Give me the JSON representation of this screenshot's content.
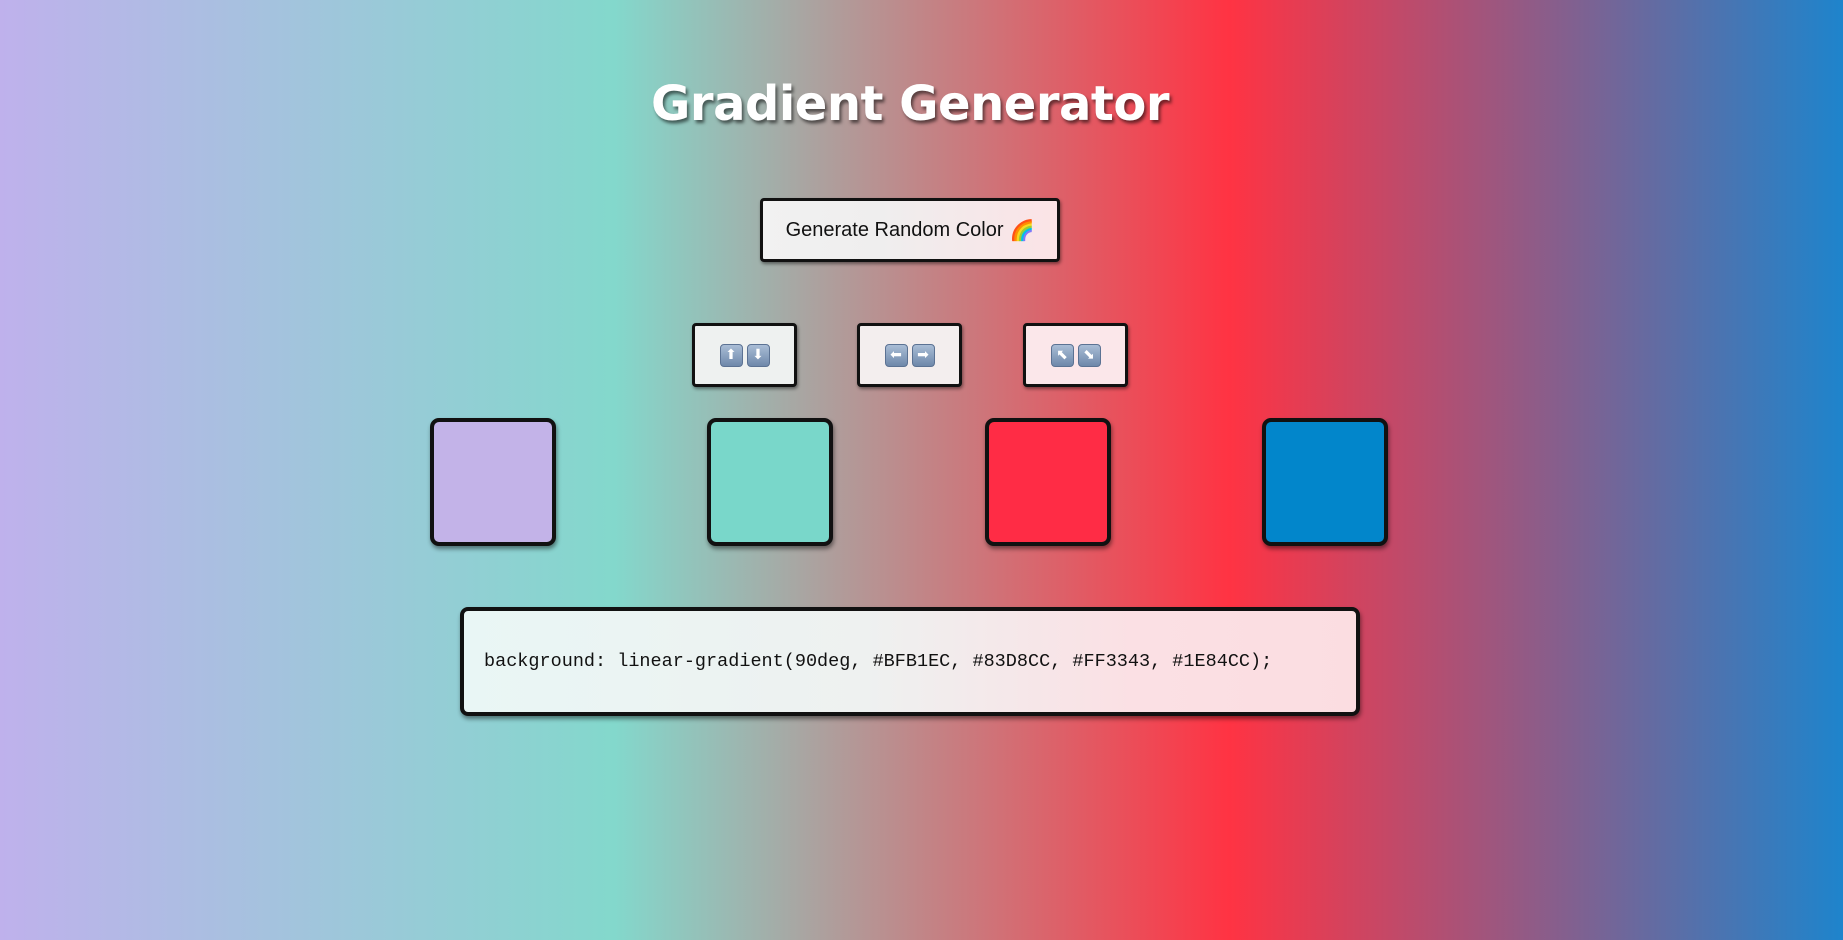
{
  "title": "Gradient Generator",
  "generate_button": {
    "label": "Generate Random Color",
    "icon": "rainbow-emoji",
    "emoji": "🌈"
  },
  "direction_buttons": [
    {
      "name": "vertical",
      "icons": [
        "arrow-up-icon",
        "arrow-down-icon"
      ],
      "glyphs": [
        "⬆",
        "⬇"
      ]
    },
    {
      "name": "horizontal",
      "icons": [
        "arrow-left-icon",
        "arrow-right-icon"
      ],
      "glyphs": [
        "⬅",
        "➡"
      ]
    },
    {
      "name": "diagonal",
      "icons": [
        "arrow-up-left-icon",
        "arrow-down-right-icon"
      ],
      "glyphs": [
        "⬉",
        "⬊"
      ]
    }
  ],
  "gradient": {
    "angle": "90deg",
    "colors": [
      "#BFB1EC",
      "#83D8CC",
      "#FF3343",
      "#1E84CC"
    ]
  },
  "swatch_display_colors": [
    "#C3B3E8",
    "#79D7CA",
    "#FF2C45",
    "#0286CB"
  ],
  "css_output": "background: linear-gradient(90deg, #BFB1EC, #83D8CC, #FF3343, #1E84CC);"
}
